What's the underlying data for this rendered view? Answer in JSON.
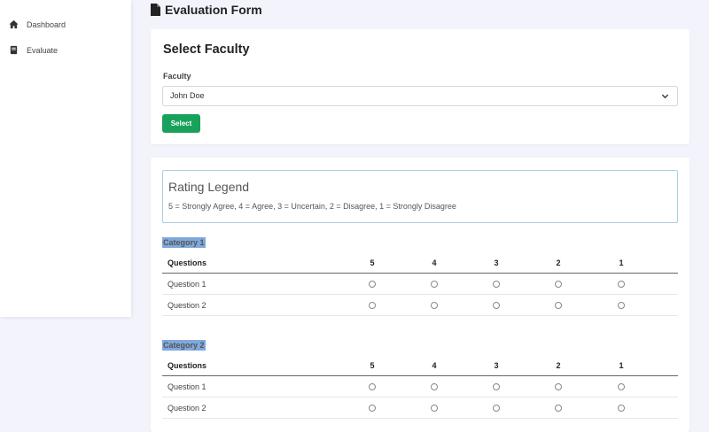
{
  "sidebar": {
    "items": [
      {
        "label": "Dashboard",
        "icon": "home-icon"
      },
      {
        "label": "Evaluate",
        "icon": "book-icon"
      }
    ]
  },
  "header": {
    "title": "Evaluation Form",
    "icon": "file-icon"
  },
  "faculty_card": {
    "title": "Select Faculty",
    "field_label": "Faculty",
    "selected_value": "John Doe",
    "button_label": "Select"
  },
  "legend": {
    "title": "Rating Legend",
    "text": "5 = Strongly Agree, 4 = Agree, 3 = Uncertain, 2 = Disagree, 1 = Strongly Disagree"
  },
  "table_headers": {
    "questions": "Questions",
    "ratings": [
      "5",
      "4",
      "3",
      "2",
      "1"
    ]
  },
  "categories": [
    {
      "name": "Category 1",
      "questions": [
        "Question 1",
        "Question 2"
      ]
    },
    {
      "name": "Category 2",
      "questions": [
        "Question 1",
        "Question 2"
      ]
    }
  ],
  "colors": {
    "accent_button": "#18a15a",
    "category_highlight": "#7fa9dd",
    "legend_border": "#a9cfe0"
  }
}
